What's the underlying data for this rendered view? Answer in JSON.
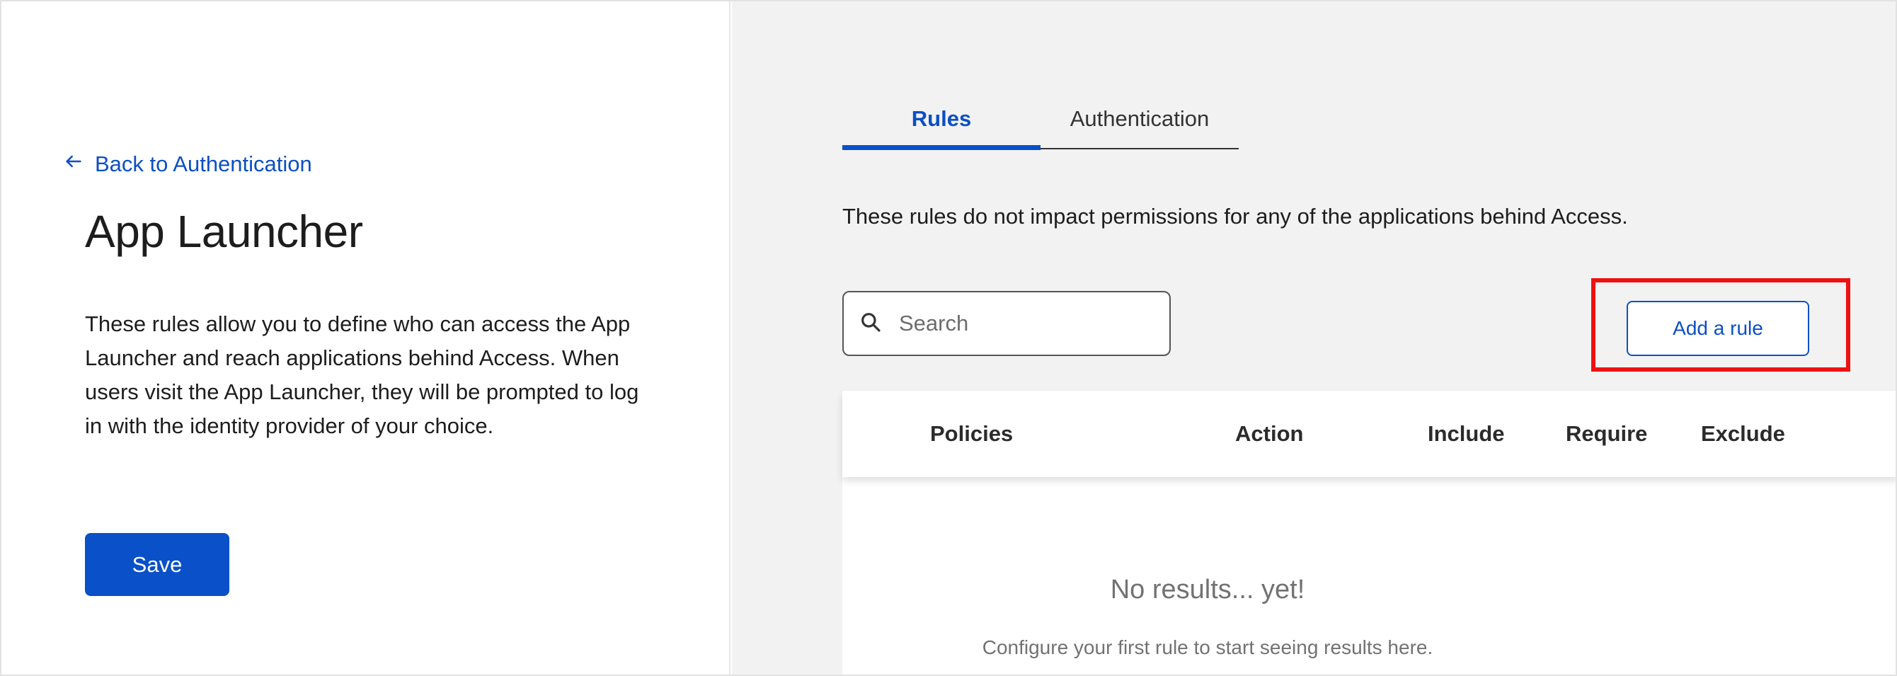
{
  "left": {
    "back_link": "Back to Authentication",
    "title": "App Launcher",
    "description": "These rules allow you to define who can access the App Launcher and reach applications behind Access. When users visit the App Launcher, they will be prompted to log in with the identity provider of your choice.",
    "save_label": "Save"
  },
  "tabs": [
    {
      "label": "Rules",
      "active": true
    },
    {
      "label": "Authentication",
      "active": false
    }
  ],
  "info_text": "These rules do not impact permissions for any of the applications behind Access.",
  "search": {
    "placeholder": "Search",
    "value": ""
  },
  "add_rule_label": "Add a rule",
  "table": {
    "columns": [
      "Policies",
      "Action",
      "Include",
      "Require",
      "Exclude"
    ],
    "empty_title": "No results... yet!",
    "empty_subtitle": "Configure your first rule to start seeing results here."
  },
  "colors": {
    "accent": "#0a50c8",
    "highlight": "#ee1111",
    "panel_bg": "#f2f2f2"
  },
  "icons": {
    "back": "arrow-left-icon",
    "search": "search-icon"
  }
}
